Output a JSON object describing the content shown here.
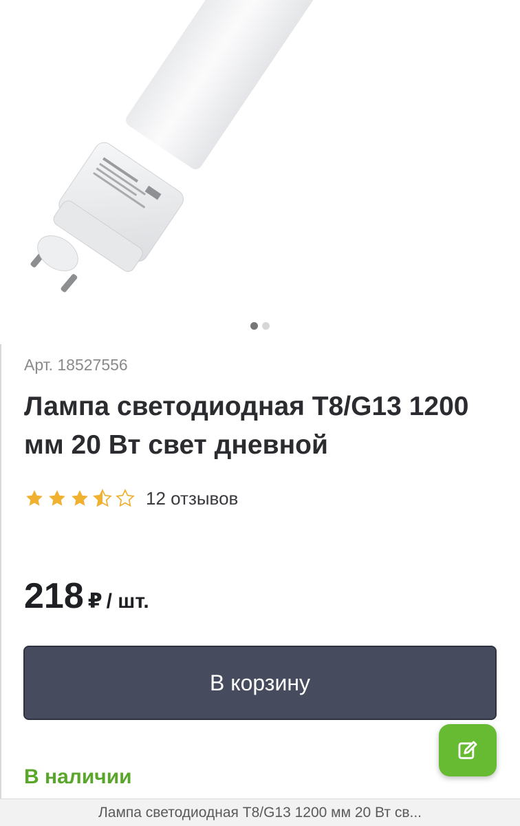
{
  "product": {
    "sku_label": "Арт. 18527556",
    "title": "Лампа светодиодная T8/G13 1200 мм 20 Вт свет дневной",
    "rating": {
      "value": 3.5,
      "max": 5,
      "reviews_label": "12 отзывов",
      "star_color": "#f0b030"
    },
    "price": {
      "value": "218",
      "currency": "₽",
      "unit": "/ шт."
    },
    "availability": "В наличии"
  },
  "gallery": {
    "image_name": "led-tube-lamp-image",
    "slides_total": 2,
    "active_slide": 1
  },
  "actions": {
    "add_to_cart_label": "В корзину",
    "fab_icon": "edit-icon"
  },
  "sticky_bar": {
    "title": "Лампа светодиодная T8/G13 1200 мм 20 Вт св..."
  },
  "colors": {
    "button_bg": "#464c5d",
    "fab_bg": "#66bb33",
    "stock_green": "#5aa62a"
  }
}
